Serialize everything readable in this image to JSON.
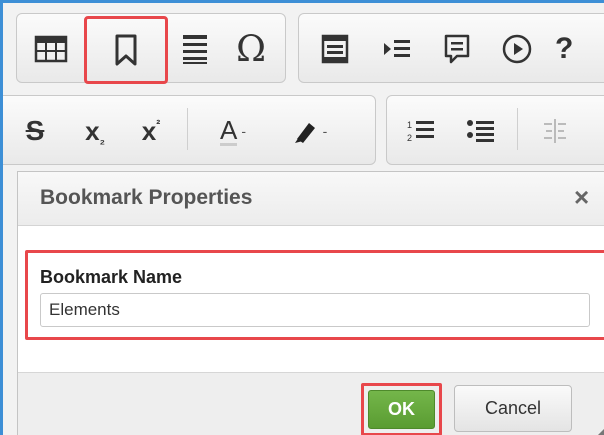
{
  "toolbar_row1": {
    "group1": [
      {
        "name": "table-icon"
      },
      {
        "name": "bookmark-icon",
        "highlighted": true
      },
      {
        "name": "horizontal-rule-icon"
      },
      {
        "name": "omega-icon",
        "glyph": "Ω"
      }
    ],
    "group2": [
      {
        "name": "page-block-icon"
      },
      {
        "name": "indent-icon"
      },
      {
        "name": "comment-icon"
      },
      {
        "name": "play-icon"
      },
      {
        "name": "help-icon",
        "glyph": "?"
      }
    ]
  },
  "toolbar_row2": {
    "group1": [
      {
        "name": "strikethrough-icon",
        "glyph": "S"
      },
      {
        "name": "subscript-icon",
        "glyph": "x"
      },
      {
        "name": "superscript-icon",
        "glyph": "x"
      },
      {
        "name": "font-color-icon",
        "glyph": "A"
      },
      {
        "name": "highlight-color-icon"
      }
    ],
    "group2": [
      {
        "name": "numbered-list-icon"
      },
      {
        "name": "bulleted-list-icon"
      },
      {
        "name": "align-icon"
      }
    ]
  },
  "dialog": {
    "title": "Bookmark Properties",
    "close_glyph": "×",
    "field_label": "Bookmark Name",
    "field_value": "Elements",
    "ok_label": "OK",
    "cancel_label": "Cancel"
  },
  "colors": {
    "highlight": "#e8474b",
    "ok_green": "#5a9c32",
    "frame_blue": "#3d8fd6"
  }
}
